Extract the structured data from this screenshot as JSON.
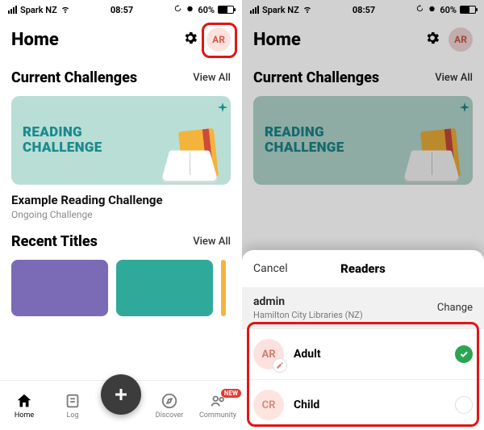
{
  "status": {
    "carrier": "Spark NZ",
    "time": "08:57",
    "battery": "60%"
  },
  "header": {
    "title": "Home",
    "avatar_initials": "AR"
  },
  "sections": {
    "challenges": {
      "heading": "Current Challenges",
      "view_all": "View All"
    },
    "recent": {
      "heading": "Recent Titles",
      "view_all": "View All"
    }
  },
  "challenge_card": {
    "banner_line1": "READING",
    "banner_line2": "CHALLENGE",
    "title": "Example Reading Challenge",
    "subtitle": "Ongoing Challenge"
  },
  "nav": {
    "items": [
      {
        "label": "Home"
      },
      {
        "label": "Log"
      },
      {
        "label": "Discover"
      },
      {
        "label": "Community"
      }
    ],
    "new_badge": "NEW"
  },
  "sheet": {
    "cancel": "Cancel",
    "title": "Readers",
    "account": {
      "name": "admin",
      "sub": "Hamilton City Libraries (NZ)",
      "change": "Change"
    },
    "readers": [
      {
        "initials": "AR",
        "name": "Adult",
        "selected": true,
        "editable": true
      },
      {
        "initials": "CR",
        "name": "Child",
        "selected": false,
        "editable": false
      }
    ]
  },
  "colors": {
    "accent_teal": "#1b8a8d",
    "highlight": "#e31414",
    "success": "#2aa552"
  }
}
